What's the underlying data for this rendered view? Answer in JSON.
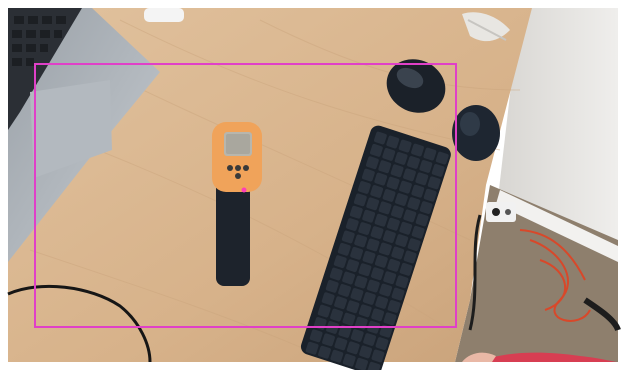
{
  "scene": {
    "objects": [
      {
        "name": "laptop",
        "label": ""
      },
      {
        "name": "infrared-thermometer",
        "label": ""
      },
      {
        "name": "wireless-keyboard",
        "label": ""
      },
      {
        "name": "computer-mouse",
        "label": ""
      },
      {
        "name": "mouse-pad-puck",
        "label": ""
      },
      {
        "name": "power-outlet",
        "label": ""
      },
      {
        "name": "cable",
        "label": ""
      }
    ],
    "colors": {
      "desk": "#d9b68f",
      "overlay_box": "#e040c8",
      "thermometer_orange": "#f0a35a",
      "dark_device": "#1d232c"
    }
  }
}
